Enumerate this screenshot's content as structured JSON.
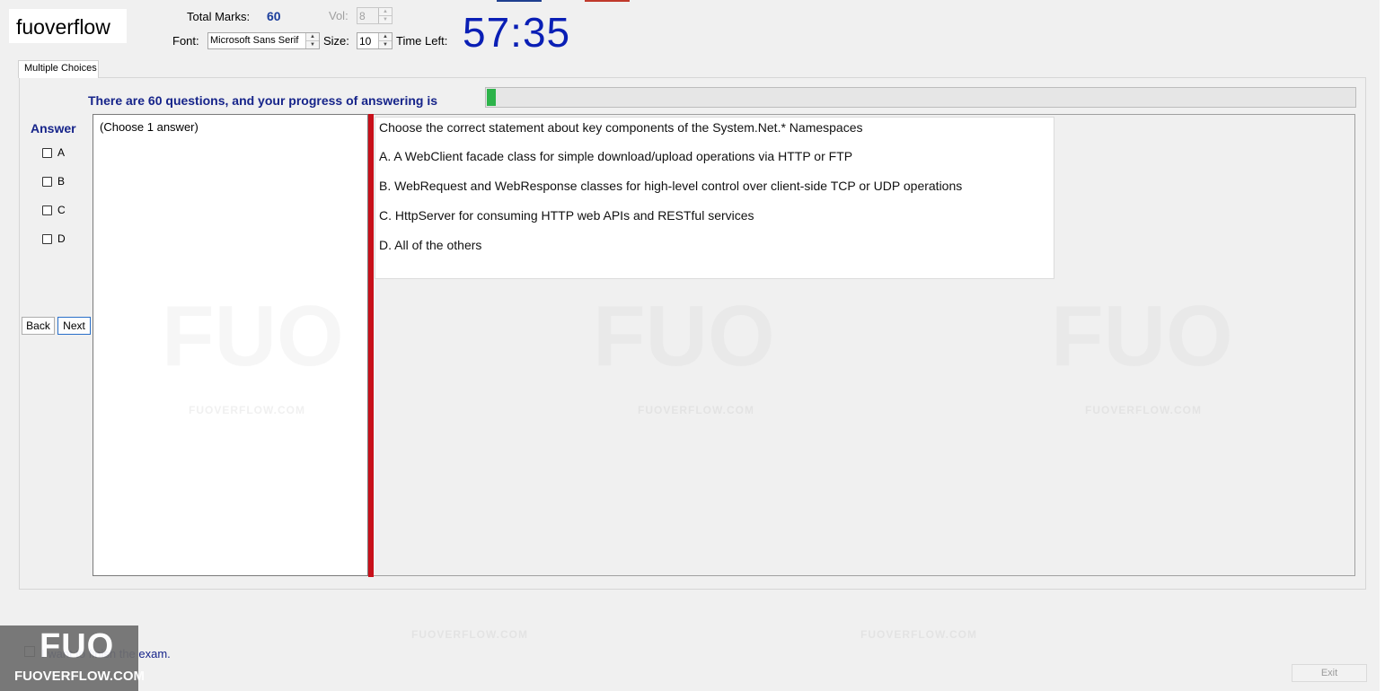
{
  "header": {
    "logo": "fuoverflow",
    "total_marks_label": "Total Marks:",
    "total_marks_value": "60",
    "vol_label": "Vol:",
    "vol_value": "8",
    "font_label": "Font:",
    "font_value": "Microsoft Sans Serif",
    "size_label": "Size:",
    "size_value": "10",
    "time_left_label": "Time Left:",
    "timer": "57:35"
  },
  "tabs": [
    {
      "label": "Multiple Choices"
    }
  ],
  "progress": {
    "text": "There are 60 questions, and your progress of answering is",
    "percent": 1
  },
  "answer": {
    "label": "Answer",
    "options": [
      "A",
      "B",
      "C",
      "D"
    ]
  },
  "nav": {
    "back_label": "Back",
    "next_label": "Next"
  },
  "left_panel": {
    "hint": "(Choose 1 answer)"
  },
  "question": {
    "stem": "Choose the correct statement about key components of the System.Net.* Namespaces",
    "options": [
      "A.  A WebClient facade class for simple download/upload operations via HTTP or FTP",
      "B.  WebRequest and WebResponse classes for high-level control over client-side TCP or UDP operations",
      "C.  HttpServer for consuming HTTP web APIs and RESTful services",
      "D.  All of the others"
    ]
  },
  "watermark": {
    "site": "FUOVERFLOW.COM",
    "big": "FUO"
  },
  "footer": {
    "finish_text": "I want to finish the exam.",
    "exit_label": "Exit"
  },
  "badge": {
    "fuo": "FUO",
    "site": "FUOVERFLOW.COM"
  },
  "colors": {
    "timer": "#0a1fb5",
    "accent_text": "#16248a",
    "progress_fill": "#2db34a",
    "divider": "#c8101a"
  }
}
